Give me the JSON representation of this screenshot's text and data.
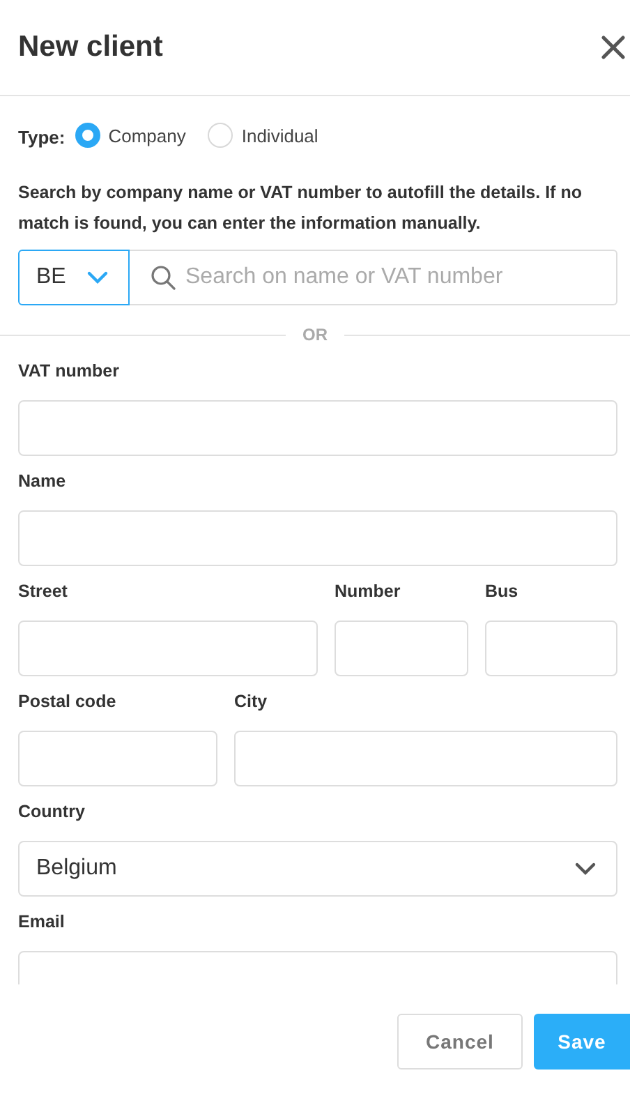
{
  "title": "New client",
  "type": {
    "label": "Type:",
    "options": [
      {
        "label": "Company",
        "selected": true
      },
      {
        "label": "Individual",
        "selected": false
      }
    ]
  },
  "search": {
    "description": "Search by company name or VAT number to autofill the details. If no match is found, you can enter the information manually.",
    "country_code": "BE",
    "placeholder": "Search on name or VAT number"
  },
  "divider": "OR",
  "rows": [
    {
      "cells": [
        {
          "label": "VAT number",
          "kind": "text"
        }
      ]
    },
    {
      "cells": [
        {
          "label": "Name",
          "kind": "text"
        }
      ]
    },
    {
      "cells": [
        {
          "label": "Street",
          "kind": "text"
        },
        {
          "label": "Number",
          "kind": "text"
        },
        {
          "label": "Bus",
          "kind": "text"
        }
      ]
    },
    {
      "cells": [
        {
          "label": "Postal code",
          "kind": "text"
        },
        {
          "label": "City",
          "kind": "text"
        }
      ]
    },
    {
      "cells": [
        {
          "label": "Country",
          "kind": "select",
          "value": "Belgium"
        }
      ]
    },
    {
      "cells": [
        {
          "label": "Email",
          "kind": "text"
        }
      ]
    }
  ],
  "buttons": [
    {
      "label": "Cancel",
      "kind": "secondary"
    },
    {
      "label": "Save",
      "kind": "primary"
    }
  ]
}
